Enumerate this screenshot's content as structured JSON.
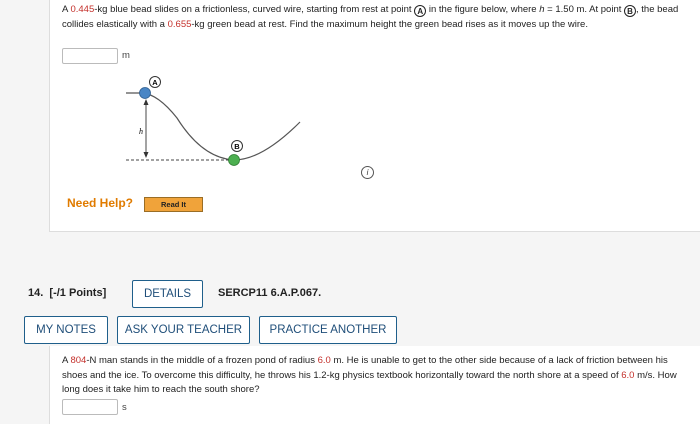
{
  "problem13": {
    "text_pre1": "A ",
    "mass1": "0.445",
    "text_pre2": "-kg blue bead slides on a frictionless, curved wire, starting from rest at point ",
    "point_a_marker": "A",
    "text_pre3": " in the figure below, where ",
    "h_symbol": "h",
    "text_pre4": " = 1.50 m. At point ",
    "point_b_marker": "B",
    "text_pre5": ", the bead collides elastically with a ",
    "mass2": "0.655",
    "text_pre6": "-kg green bead at rest. Find the maximum height the green bead rises as it moves up the wire.",
    "answer_value": "",
    "unit": "m",
    "figure": {
      "label_a": "A",
      "label_b": "B",
      "label_h": "h"
    },
    "need_help_label": "Need Help?",
    "read_it_label": "Read It",
    "info_icon": "info-icon",
    "info_glyph": "i"
  },
  "problem14": {
    "number": "14.",
    "points": "[-/1 Points]",
    "details_label": "DETAILS",
    "code": "SERCP11 6.A.P.067.",
    "my_notes_label": "MY NOTES",
    "ask_teacher_label": "ASK YOUR TEACHER",
    "practice_label": "PRACTICE ANOTHER",
    "text_pre1": "A ",
    "force": "804",
    "text_pre2": "-N man stands in the middle of a frozen pond of radius ",
    "radius": "6.0",
    "text_pre3": " m. He is unable to get to the other side because of a lack of friction between his shoes and the ice. To overcome this difficulty, he throws his 1.2-kg physics textbook horizontally toward the north shore at a speed of ",
    "speed": "6.0",
    "text_pre4": " m/s. How long does it take him to reach the south shore?",
    "answer_value": "",
    "unit": "s"
  },
  "colors": {
    "highlight": "#c4302b",
    "blue_bead": "#4a86c5",
    "green_bead": "#4caf50",
    "need_help": "#e07b00",
    "button_border": "#1f5f8b"
  }
}
